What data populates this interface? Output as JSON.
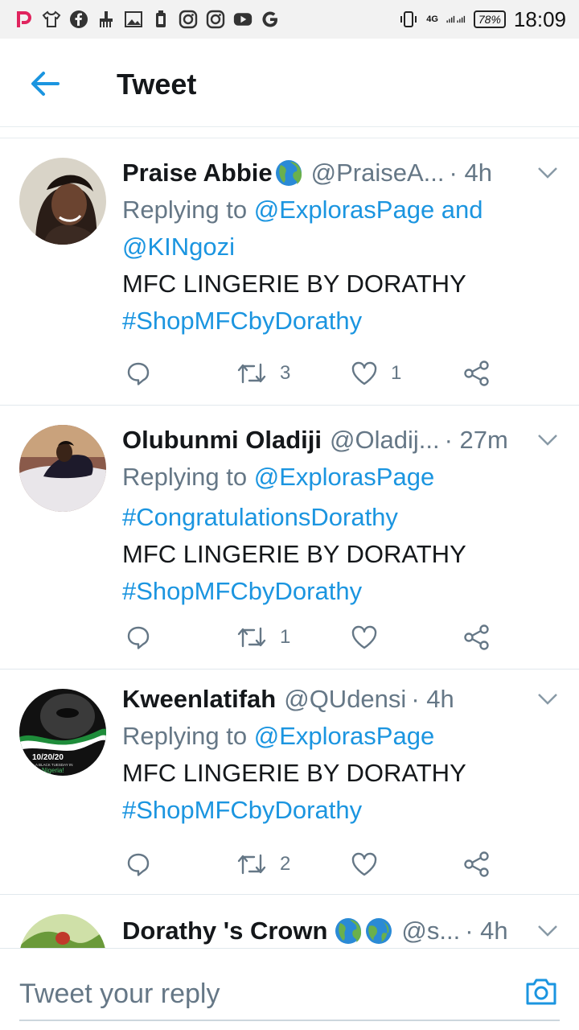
{
  "status_bar": {
    "left_icons": [
      "picsart-icon",
      "tshirt-icon",
      "facebook-icon",
      "cleaner-icon",
      "gallery-icon",
      "battery-saver-icon",
      "instagram-icon",
      "instagram-icon",
      "youtube-icon",
      "google-icon"
    ],
    "network": "4G",
    "battery": "78%",
    "time": "18:09"
  },
  "header": {
    "title": "Tweet"
  },
  "tweets": [
    {
      "name": "Praise Abbie",
      "name_emoji": "🌍",
      "handle": "@PraiseA...",
      "time": "· 4h",
      "replying_prefix": "Replying to",
      "reply_line1_link": "@ExplorasPage and",
      "reply_line2_link": "@KINgozi",
      "body": "MFC LINGERIE BY DORATHY",
      "hashtag": "#ShopMFCbyDorathy",
      "retweets": "3",
      "likes": "1"
    },
    {
      "name": "Olubunmi Oladiji",
      "handle": "@Oladij...",
      "time": "· 27m",
      "replying_prefix": "Replying to",
      "reply_link": "@ExplorasPage",
      "hashtag1": "#CongratulationsDorathy",
      "body": "MFC LINGERIE BY DORATHY",
      "hashtag2": "#ShopMFCbyDorathy",
      "retweets": "1",
      "likes": ""
    },
    {
      "name": "Kweenlatifah",
      "handle": "@QUdensi",
      "time": "· 4h",
      "replying_prefix": "Replying to",
      "reply_link": "@ExplorasPage",
      "body": "MFC LINGERIE BY DORATHY",
      "hashtag": "#ShopMFCbyDorathy",
      "retweets": "2",
      "likes": "",
      "avatar_text_date": "10/20/20",
      "avatar_text_sub": "A BLACK TUESDAY IN",
      "avatar_text_country": "Nigeria!"
    },
    {
      "name": "Dorathy 's Crown",
      "handle": "@s...",
      "time": "· 4h"
    }
  ],
  "composer": {
    "placeholder": "Tweet your reply"
  },
  "colors": {
    "accent": "#1b95e0",
    "secondary_text": "#657786",
    "primary_text": "#14171a"
  }
}
